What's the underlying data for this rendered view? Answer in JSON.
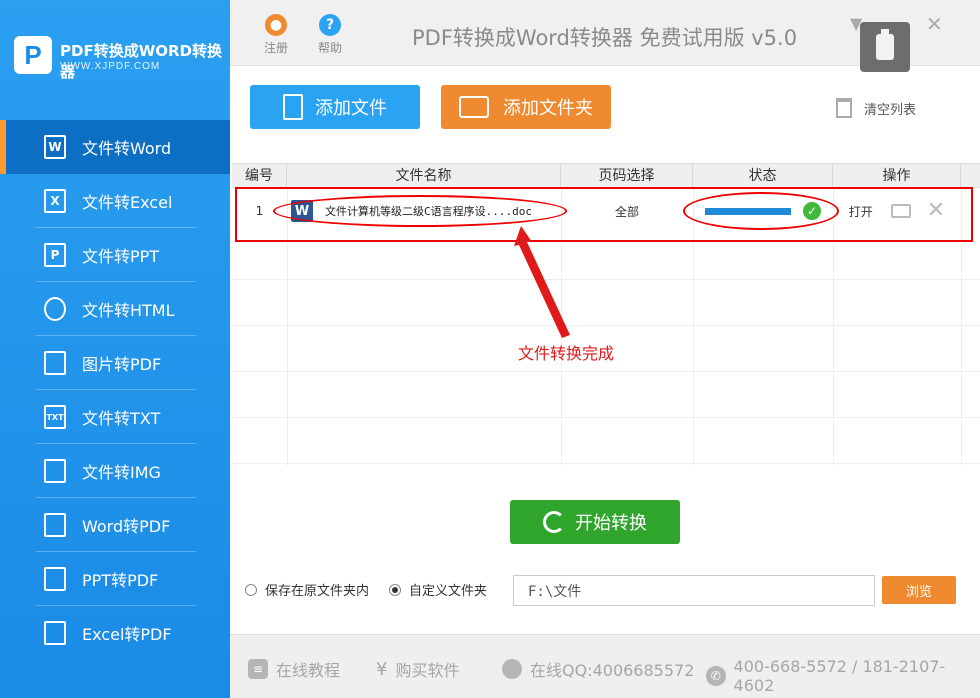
{
  "logo": {
    "mark": "P",
    "title": "PDF转换成WORD转换器",
    "url": "WWW.XJPDF.COM"
  },
  "header": {
    "title": "PDF转换成Word转换器 免费试用版 v5.0",
    "register_label": "注册",
    "help_label": "帮助"
  },
  "sidebar": {
    "items": [
      {
        "label": "文件转Word",
        "icon": "W"
      },
      {
        "label": "文件转Excel",
        "icon": "X"
      },
      {
        "label": "文件转PPT",
        "icon": "P"
      },
      {
        "label": "文件转HTML",
        "icon": ""
      },
      {
        "label": "图片转PDF",
        "icon": ""
      },
      {
        "label": "文件转TXT",
        "icon": "TXT"
      },
      {
        "label": "文件转IMG",
        "icon": ""
      },
      {
        "label": "Word转PDF",
        "icon": ""
      },
      {
        "label": "PPT转PDF",
        "icon": ""
      },
      {
        "label": "Excel转PDF",
        "icon": ""
      }
    ]
  },
  "toolbar": {
    "add_file_label": "添加文件",
    "add_folder_label": "添加文件夹",
    "clear_list_label": "清空列表"
  },
  "table": {
    "headers": [
      "编号",
      "文件名称",
      "页码选择",
      "状态",
      "操作"
    ],
    "rows": [
      {
        "index": "1",
        "file_icon": "W",
        "filename": "文件计算机等级二级C语言程序设....doc",
        "pages": "全部",
        "progress": 1.0,
        "action_open": "打开"
      }
    ]
  },
  "annotation": {
    "text": "文件转换完成",
    "color": "#e01a1a"
  },
  "convert": {
    "start_label": "开始转换"
  },
  "output": {
    "save_original_label": "保存在原文件夹内",
    "custom_folder_label": "自定义文件夹",
    "selected": "custom",
    "path_value": "F:\\文件",
    "browse_label": "浏览"
  },
  "footer": {
    "tutorial_label": "在线教程",
    "buy_label": "购买软件",
    "qq_label": "在线QQ:4006685572",
    "phone_label": "400-668-5572 / 181-2107-4602"
  },
  "colors": {
    "sidebar": "#1a8be6",
    "accent_blue": "#2aa4f2",
    "accent_orange": "#f08a30",
    "start_green": "#2fa62b",
    "annotation_red": "#e00000"
  }
}
